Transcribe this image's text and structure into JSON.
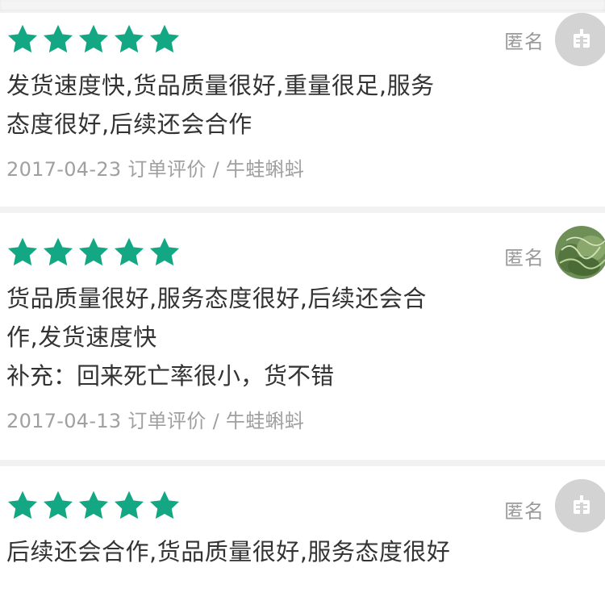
{
  "colors": {
    "star": "#13a784",
    "text": "#333333",
    "meta": "#a0a0a0",
    "separator": "#f2f2f2",
    "avatar_gray": "#d3d3d3"
  },
  "reviews": [
    {
      "rating": 5,
      "user_label": "匿名",
      "avatar": "default-avatar-icon",
      "text": "发货速度快,货品质量很好,重量很足,服务态度很好,后续还会合作",
      "date": "2017-04-23",
      "meta_label": "订单评价",
      "separator": "/",
      "product": "牛蛙蝌蚪"
    },
    {
      "rating": 5,
      "user_label": "匿名",
      "avatar": "plant-photo-avatar",
      "text": "货品质量很好,服务态度很好,后续还会合作,发货速度快",
      "supplement": "补充：回来死亡率很小，货不错",
      "date": "2017-04-13",
      "meta_label": "订单评价",
      "separator": "/",
      "product": "牛蛙蝌蚪"
    },
    {
      "rating": 5,
      "user_label": "匿名",
      "avatar": "default-avatar-icon",
      "text": "后续还会合作,货品质量很好,服务态度很好"
    }
  ]
}
